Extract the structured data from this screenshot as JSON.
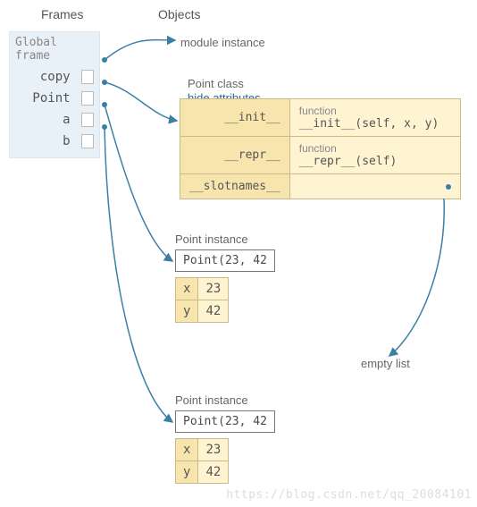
{
  "headers": {
    "frames": "Frames",
    "objects": "Objects"
  },
  "frame": {
    "title": "Global frame",
    "vars": [
      "copy",
      "Point",
      "a",
      "b"
    ]
  },
  "labels": {
    "module_instance": "module instance",
    "point_class": "Point class",
    "hide_attributes": "hide attributes",
    "point_instance": "Point instance",
    "empty_list": "empty list"
  },
  "class_table": {
    "rows": [
      {
        "name": "__init__",
        "func_label": "function",
        "func_sig": "__init__(self, x, y)"
      },
      {
        "name": "__repr__",
        "func_label": "function",
        "func_sig": "__repr__(self)"
      },
      {
        "name": "__slotnames__",
        "func_label": "",
        "func_sig": ""
      }
    ]
  },
  "instances": [
    {
      "repr": "Point(23, 42",
      "attrs": [
        {
          "k": "x",
          "v": "23"
        },
        {
          "k": "y",
          "v": "42"
        }
      ]
    },
    {
      "repr": "Point(23, 42",
      "attrs": [
        {
          "k": "x",
          "v": "23"
        },
        {
          "k": "y",
          "v": "42"
        }
      ]
    }
  ],
  "watermark": "https://blog.csdn.net/qq_20084101",
  "chart_data": {
    "type": "diagram",
    "description": "Python Tutor style frame/object diagram",
    "global_frame": {
      "copy": "→ module instance",
      "Point": "→ Point class {__init__: function __init__(self, x, y), __repr__: function __repr__(self), __slotnames__: → empty list}",
      "a": "→ Point instance {x:23, y:42} repr 'Point(23, 42'",
      "b": "→ Point instance {x:23, y:42} repr 'Point(23, 42'"
    }
  }
}
